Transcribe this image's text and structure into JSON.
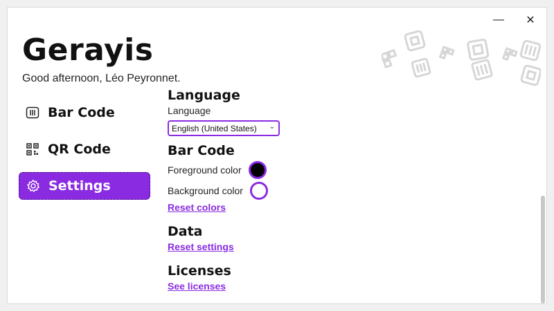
{
  "window": {
    "minimize_glyph": "—",
    "close_glyph": "✕"
  },
  "app": {
    "title": "Gerayis",
    "greeting": "Good afternoon, Léo Peyronnet."
  },
  "nav": {
    "items": [
      {
        "label": "Bar Code",
        "icon": "barcode-icon",
        "active": false
      },
      {
        "label": "QR Code",
        "icon": "qrcode-icon",
        "active": false
      },
      {
        "label": "Settings",
        "icon": "gear-icon",
        "active": true
      }
    ]
  },
  "settings": {
    "language": {
      "heading": "Language",
      "label": "Language",
      "selected": "English (United States)"
    },
    "bar_code": {
      "heading": "Bar Code",
      "foreground_label": "Foreground color",
      "foreground_color": "#000000",
      "background_label": "Background color",
      "background_color": "#ffffff",
      "reset_colors": "Reset colors"
    },
    "data": {
      "heading": "Data",
      "reset_settings": "Reset settings"
    },
    "licenses": {
      "heading": "Licenses",
      "see_licenses": "See licenses"
    }
  },
  "colors": {
    "accent": "#8a2be2"
  }
}
